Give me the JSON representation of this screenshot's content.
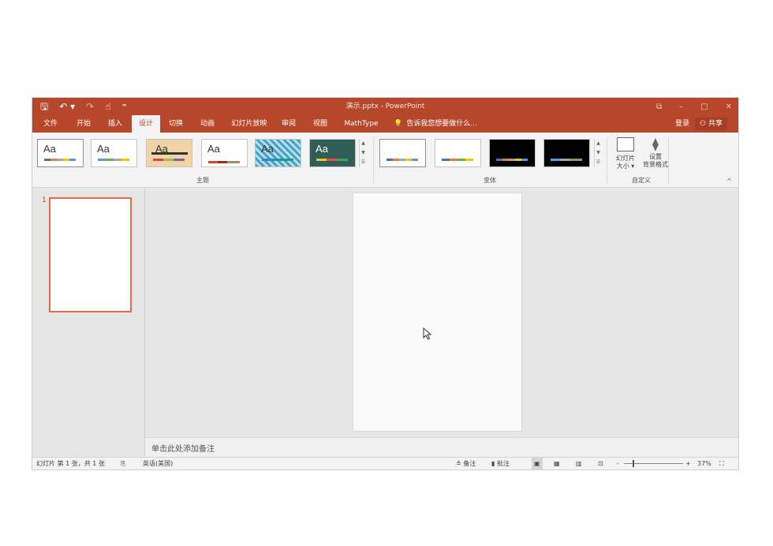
{
  "titlebar": {
    "title": "演示.pptx - PowerPoint",
    "qat": {
      "save": "🖫",
      "undo": "↶ ▾",
      "redo": "↷",
      "touch": "☝",
      "customize": "⁼"
    },
    "controls": {
      "options": "⧉",
      "minimize": "–",
      "maximize": "□",
      "close": "✕"
    }
  },
  "tabs": [
    {
      "label": "文件"
    },
    {
      "label": "开始"
    },
    {
      "label": "插入"
    },
    {
      "label": "设计"
    },
    {
      "label": "切换"
    },
    {
      "label": "动画"
    },
    {
      "label": "幻灯片放映"
    },
    {
      "label": "审阅"
    },
    {
      "label": "视图"
    },
    {
      "label": "MathType"
    }
  ],
  "active_tab": "设计",
  "tellme": {
    "text": "告诉我您想要做什么...",
    "icon": "lightbulb-icon"
  },
  "account": {
    "login": "登录",
    "share": "共享"
  },
  "ribbon": {
    "themes_label": "主题",
    "variants_label": "变体",
    "customize_label": "自定义",
    "theme_thumb_text": "Aa",
    "slide_size": {
      "line1": "幻灯片",
      "line2": "大小 ▾"
    },
    "format_bg": {
      "line1": "设置",
      "line2": "背景格式"
    },
    "collapse": "^"
  },
  "slides": {
    "thumb_number": "1"
  },
  "notes": {
    "placeholder": "单击此处添加备注"
  },
  "statusbar": {
    "slide_info": "幻灯片 第 1 张，共 1 张",
    "language": "英语(美国)",
    "notes": "≙ 备注",
    "comments": "▮ 批注",
    "zoom_minus": "-",
    "zoom_plus": "+",
    "zoom_percent": "37%"
  },
  "colors": {
    "brand": "#b7472a",
    "thumb_border": "#e86a4a"
  }
}
